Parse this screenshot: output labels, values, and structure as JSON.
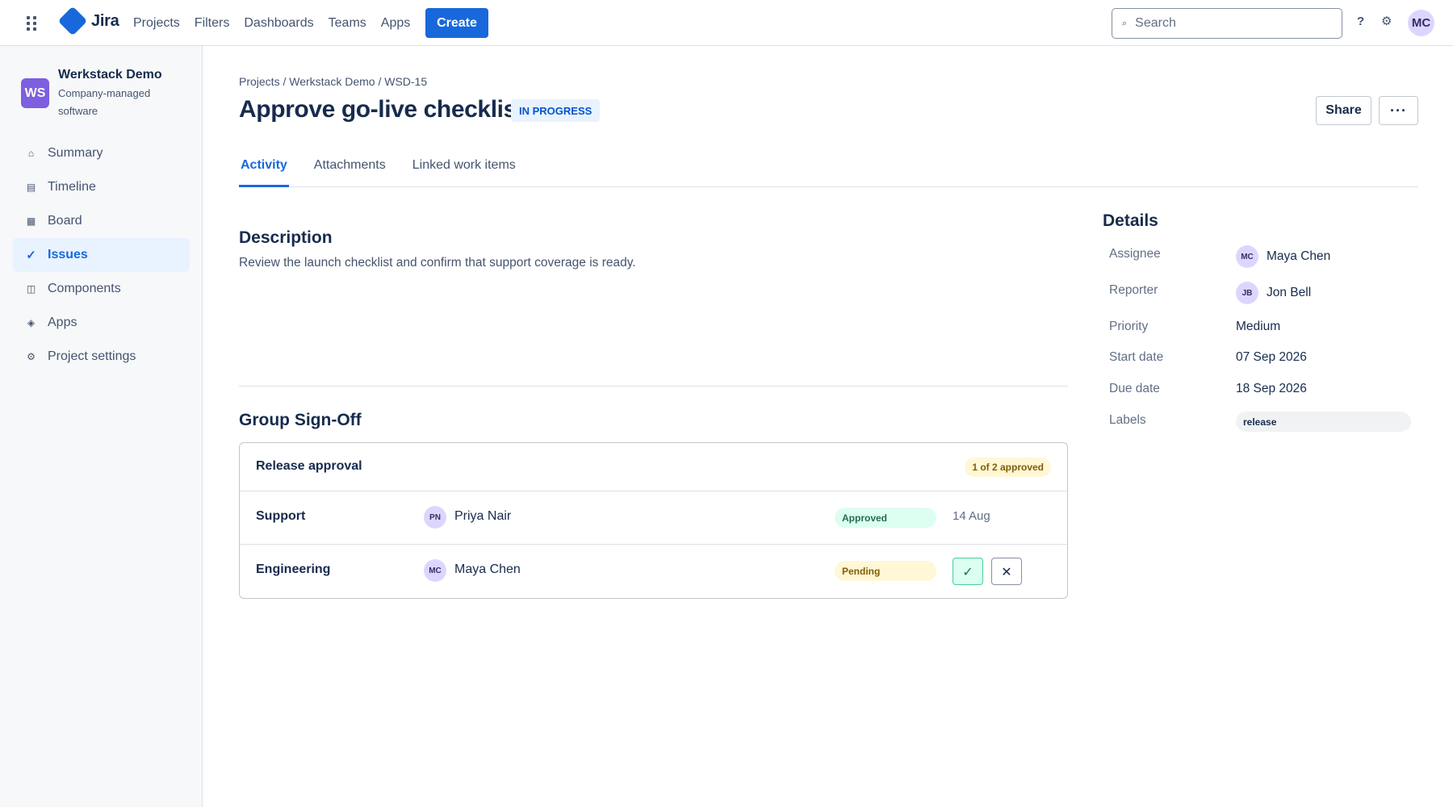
{
  "topnav": {
    "logo_text": "Jira",
    "items": [
      "Projects",
      "Filters",
      "Dashboards",
      "Teams",
      "Apps"
    ],
    "create_label": "Create",
    "search_placeholder": "Search",
    "help_glyph": "?",
    "user_initials": "MC",
    "icons": {
      "apps": "app-grid-icon",
      "search": "search-icon",
      "help": "help-icon",
      "settings": "gear-icon"
    },
    "brand_color": "#1868db"
  },
  "sidebar": {
    "project_initials": "WS",
    "project_name": "Werkstack Demo",
    "project_type": "Company-managed software",
    "items": [
      {
        "label": "Summary",
        "icon": "home-icon",
        "glyph": "⌂"
      },
      {
        "label": "Timeline",
        "icon": "timeline-icon",
        "glyph": "▤"
      },
      {
        "label": "Board",
        "icon": "board-icon",
        "glyph": "▦"
      },
      {
        "label": "Issues",
        "icon": "check-icon",
        "glyph": "✓",
        "active": true
      },
      {
        "label": "Components",
        "icon": "components-icon",
        "glyph": "◫"
      },
      {
        "label": "Apps",
        "icon": "apps-icon",
        "glyph": "◈"
      },
      {
        "label": "Project settings",
        "icon": "gear-icon",
        "glyph": "⚙"
      }
    ]
  },
  "issue": {
    "breadcrumb": "Projects / Werkstack Demo / WSD-15",
    "title": "Approve go-live checklist",
    "status": "IN PROGRESS",
    "share_label": "Share",
    "more_label": "···",
    "tabs": [
      "Activity",
      "Attachments",
      "Linked work items"
    ],
    "description_heading": "Description",
    "description": "Review the launch checklist and confirm that support coverage is ready.",
    "signoff_heading": "Group Sign-Off"
  },
  "signoff": {
    "title": "Release approval",
    "count": "1 of 2 approved",
    "rows": [
      {
        "group": "Support",
        "initials": "PN",
        "name": "Priya Nair",
        "status": "Approved",
        "date": "14 Aug"
      },
      {
        "group": "Engineering",
        "initials": "MC",
        "name": "Maya Chen",
        "status": "Pending",
        "approve_glyph": "✓",
        "reject_glyph": "✕"
      }
    ]
  },
  "details": {
    "heading": "Details",
    "assignee_label": "Assignee",
    "assignee_initials": "MC",
    "assignee": "Maya Chen",
    "reporter_label": "Reporter",
    "reporter_initials": "JB",
    "reporter": "Jon Bell",
    "priority_label": "Priority",
    "priority": "Medium",
    "start_label": "Start date",
    "start": "07 Sep 2026",
    "due_label": "Due date",
    "due": "18 Sep 2026",
    "labels_label": "Labels",
    "label": "release"
  }
}
